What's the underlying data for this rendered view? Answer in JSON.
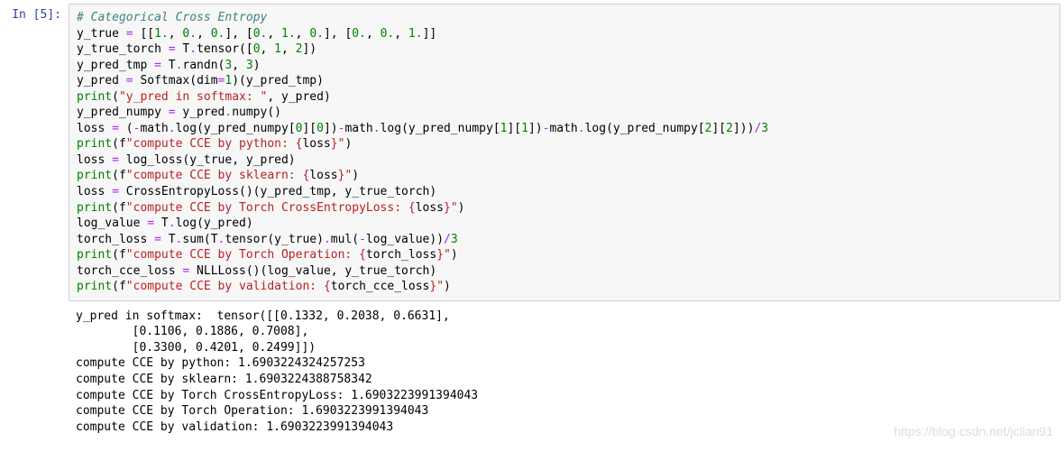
{
  "prompt": {
    "in_label": "In [5]:"
  },
  "code": {
    "l1_comment": "# Categorical Cross Entropy",
    "l2_a": "y_true ",
    "l2_op": "=",
    "l2_b": " [[",
    "l2_n1": "1.",
    "l2_c": ", ",
    "l2_n2": "0.",
    "l2_d": ", ",
    "l2_n3": "0.",
    "l2_e": "], [",
    "l2_n4": "0.",
    "l2_f": ", ",
    "l2_n5": "1.",
    "l2_g": ", ",
    "l2_n6": "0.",
    "l2_h": "], [",
    "l2_n7": "0.",
    "l2_i": ", ",
    "l2_n8": "0.",
    "l2_j": ", ",
    "l2_n9": "1.",
    "l2_k": "]]",
    "l3_a": "y_true_torch ",
    "l3_op": "=",
    "l3_b": " T",
    "l3_dot": ".",
    "l3_c": "tensor([",
    "l3_n1": "0",
    "l3_d": ", ",
    "l3_n2": "1",
    "l3_e": ", ",
    "l3_n3": "2",
    "l3_f": "])",
    "l4_a": "y_pred_tmp ",
    "l4_op": "=",
    "l4_b": " T",
    "l4_dot": ".",
    "l4_c": "randn(",
    "l4_n1": "3",
    "l4_d": ", ",
    "l4_n2": "3",
    "l4_e": ")",
    "l5_a": "y_pred ",
    "l5_op": "=",
    "l5_b": " Softmax(dim",
    "l5_op2": "=",
    "l5_n1": "1",
    "l5_c": ")(y_pred_tmp)",
    "l6_a": "print",
    "l6_b": "(",
    "l6_s": "\"y_pred in softmax: \"",
    "l6_c": ", y_pred)",
    "l7_a": "y_pred_numpy ",
    "l7_op": "=",
    "l7_b": " y_pred",
    "l7_dot": ".",
    "l7_c": "numpy()",
    "l8_a": "loss ",
    "l8_op": "=",
    "l8_b": " (",
    "l8_op2": "-",
    "l8_c": "math",
    "l8_dot1": ".",
    "l8_d": "log(y_pred_numpy[",
    "l8_n1": "0",
    "l8_e": "][",
    "l8_n2": "0",
    "l8_f": "])",
    "l8_op3": "-",
    "l8_g": "math",
    "l8_dot2": ".",
    "l8_h": "log(y_pred_numpy[",
    "l8_n3": "1",
    "l8_i": "][",
    "l8_n4": "1",
    "l8_j": "])",
    "l8_op4": "-",
    "l8_k": "math",
    "l8_dot3": ".",
    "l8_l": "log(y_pred_numpy[",
    "l8_n5": "2",
    "l8_m": "][",
    "l8_n6": "2",
    "l8_n": "]))",
    "l8_op5": "/",
    "l8_n7": "3",
    "l9_a": "print",
    "l9_b": "(f",
    "l9_s1": "\"compute CCE by python: ",
    "l9_br1": "{",
    "l9_v": "loss",
    "l9_br2": "}",
    "l9_s2": "\"",
    "l9_c": ")",
    "l10_a": "loss ",
    "l10_op": "=",
    "l10_b": " log_loss(y_true, y_pred)",
    "l11_a": "print",
    "l11_b": "(f",
    "l11_s1": "\"compute CCE by sklearn: ",
    "l11_br1": "{",
    "l11_v": "loss",
    "l11_br2": "}",
    "l11_s2": "\"",
    "l11_c": ")",
    "l12_a": "loss ",
    "l12_op": "=",
    "l12_b": " CrossEntropyLoss()(y_pred_tmp, y_true_torch)",
    "l13_a": "print",
    "l13_b": "(f",
    "l13_s1": "\"compute CCE by Torch CrossEntropyLoss: ",
    "l13_br1": "{",
    "l13_v": "loss",
    "l13_br2": "}",
    "l13_s2": "\"",
    "l13_c": ")",
    "l14_a": "log_value ",
    "l14_op": "=",
    "l14_b": " T",
    "l14_dot": ".",
    "l14_c": "log(y_pred)",
    "l15_a": "torch_loss ",
    "l15_op": "=",
    "l15_b": " T",
    "l15_dot1": ".",
    "l15_c": "sum(T",
    "l15_dot2": ".",
    "l15_d": "tensor(y_true)",
    "l15_dot3": ".",
    "l15_e": "mul(",
    "l15_op2": "-",
    "l15_f": "log_value))",
    "l15_op3": "/",
    "l15_n1": "3",
    "l16_a": "print",
    "l16_b": "(f",
    "l16_s1": "\"compute CCE by Torch Operation: ",
    "l16_br1": "{",
    "l16_v": "torch_loss",
    "l16_br2": "}",
    "l16_s2": "\"",
    "l16_c": ")",
    "l17_a": "torch_cce_loss ",
    "l17_op": "=",
    "l17_b": " NLLLoss()(log_value, y_true_torch)",
    "l18_a": "print",
    "l18_b": "(f",
    "l18_s1": "\"compute CCE by validation: ",
    "l18_br1": "{",
    "l18_v": "torch_cce_loss",
    "l18_br2": "}",
    "l18_s2": "\"",
    "l18_c": ")"
  },
  "output": {
    "l1": "y_pred in softmax:  tensor([[0.1332, 0.2038, 0.6631],",
    "l2": "        [0.1106, 0.1886, 0.7008],",
    "l3": "        [0.3300, 0.4201, 0.2499]])",
    "l4": "compute CCE by python: 1.6903224324257253",
    "l5": "compute CCE by sklearn: 1.6903224388758342",
    "l6": "compute CCE by Torch CrossEntropyLoss: 1.6903223991394043",
    "l7": "compute CCE by Torch Operation: 1.6903223991394043",
    "l8": "compute CCE by validation: 1.6903223991394043"
  },
  "watermark": "https://blog.csdn.net/jclian91"
}
